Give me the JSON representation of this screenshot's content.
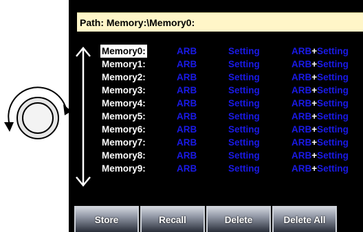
{
  "path_bar": {
    "text": "Path: Memory:\\Memory0:"
  },
  "memory_list": {
    "rows": [
      {
        "name": "Memory0:",
        "arb": "ARB",
        "setting": "Setting",
        "combo_a": "ARB",
        "combo_plus": "+",
        "combo_b": "Setting"
      },
      {
        "name": "Memory1:",
        "arb": "ARB",
        "setting": "Setting",
        "combo_a": "ARB",
        "combo_plus": "+",
        "combo_b": "Setting"
      },
      {
        "name": "Memory2:",
        "arb": "ARB",
        "setting": "Setting",
        "combo_a": "ARB",
        "combo_plus": "+",
        "combo_b": "Setting"
      },
      {
        "name": "Memory3:",
        "arb": "ARB",
        "setting": "Setting",
        "combo_a": "ARB",
        "combo_plus": "+",
        "combo_b": "Setting"
      },
      {
        "name": "Memory4:",
        "arb": "ARB",
        "setting": "Setting",
        "combo_a": "ARB",
        "combo_plus": "+",
        "combo_b": "Setting"
      },
      {
        "name": "Memory5:",
        "arb": "ARB",
        "setting": "Setting",
        "combo_a": "ARB",
        "combo_plus": "+",
        "combo_b": "Setting"
      },
      {
        "name": "Memory6:",
        "arb": "ARB",
        "setting": "Setting",
        "combo_a": "ARB",
        "combo_plus": "+",
        "combo_b": "Setting"
      },
      {
        "name": "Memory7:",
        "arb": "ARB",
        "setting": "Setting",
        "combo_a": "ARB",
        "combo_plus": "+",
        "combo_b": "Setting"
      },
      {
        "name": "Memory8:",
        "arb": "ARB",
        "setting": "Setting",
        "combo_a": "ARB",
        "combo_plus": "+",
        "combo_b": "Setting"
      },
      {
        "name": "Memory9:",
        "arb": "ARB",
        "setting": "Setting",
        "combo_a": "ARB",
        "combo_plus": "+",
        "combo_b": "Setting"
      }
    ]
  },
  "softkeys": {
    "store": "Store",
    "recall": "Recall",
    "delete": "Delete",
    "delete_all": "Delete All"
  },
  "colors": {
    "screen_bg": "#000000",
    "path_bar_bg": "#fff6c8",
    "option_text": "#1a1ae6",
    "selected_bg": "#ffffff"
  },
  "icons": {
    "knob": "rotary-knob-icon",
    "scroll": "up-down-arrow-icon"
  }
}
